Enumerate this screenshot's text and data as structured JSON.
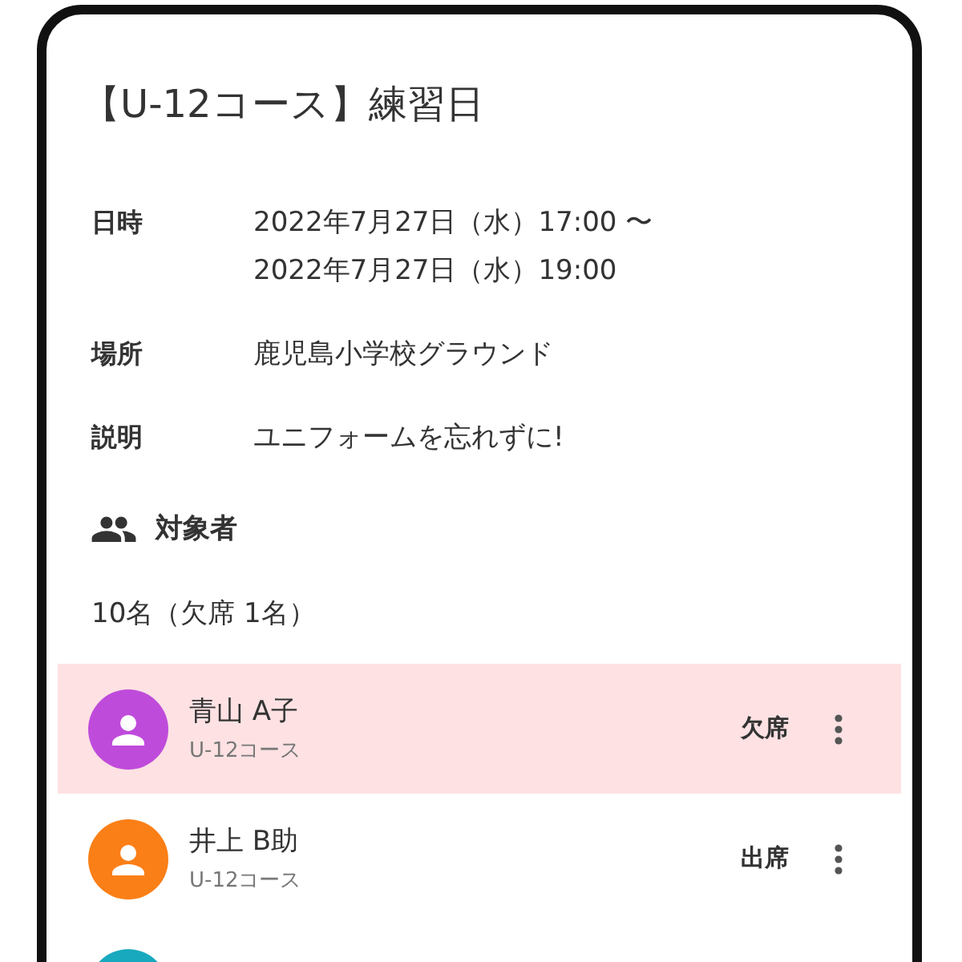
{
  "title": "【U-12コース】練習日",
  "details": [
    {
      "label": "日時",
      "lines": [
        "2022年7月27日（水）17:00 〜",
        "2022年7月27日（水）19:00"
      ]
    },
    {
      "label": "場所",
      "lines": [
        "鹿児島小学校グラウンド"
      ]
    },
    {
      "label": "説明",
      "lines": [
        "ユニフォームを忘れずに!"
      ]
    }
  ],
  "attendees": {
    "heading": "対象者",
    "count": "10名（欠席 1名）",
    "members": [
      {
        "name": "青山 A子",
        "course": "U-12コース",
        "status": "欠席",
        "absent": true,
        "color": "#bf4bdb"
      },
      {
        "name": "井上 B助",
        "course": "U-12コース",
        "status": "出席",
        "absent": false,
        "color": "#fb7f17"
      },
      {
        "color": "#18a9bf"
      }
    ]
  }
}
